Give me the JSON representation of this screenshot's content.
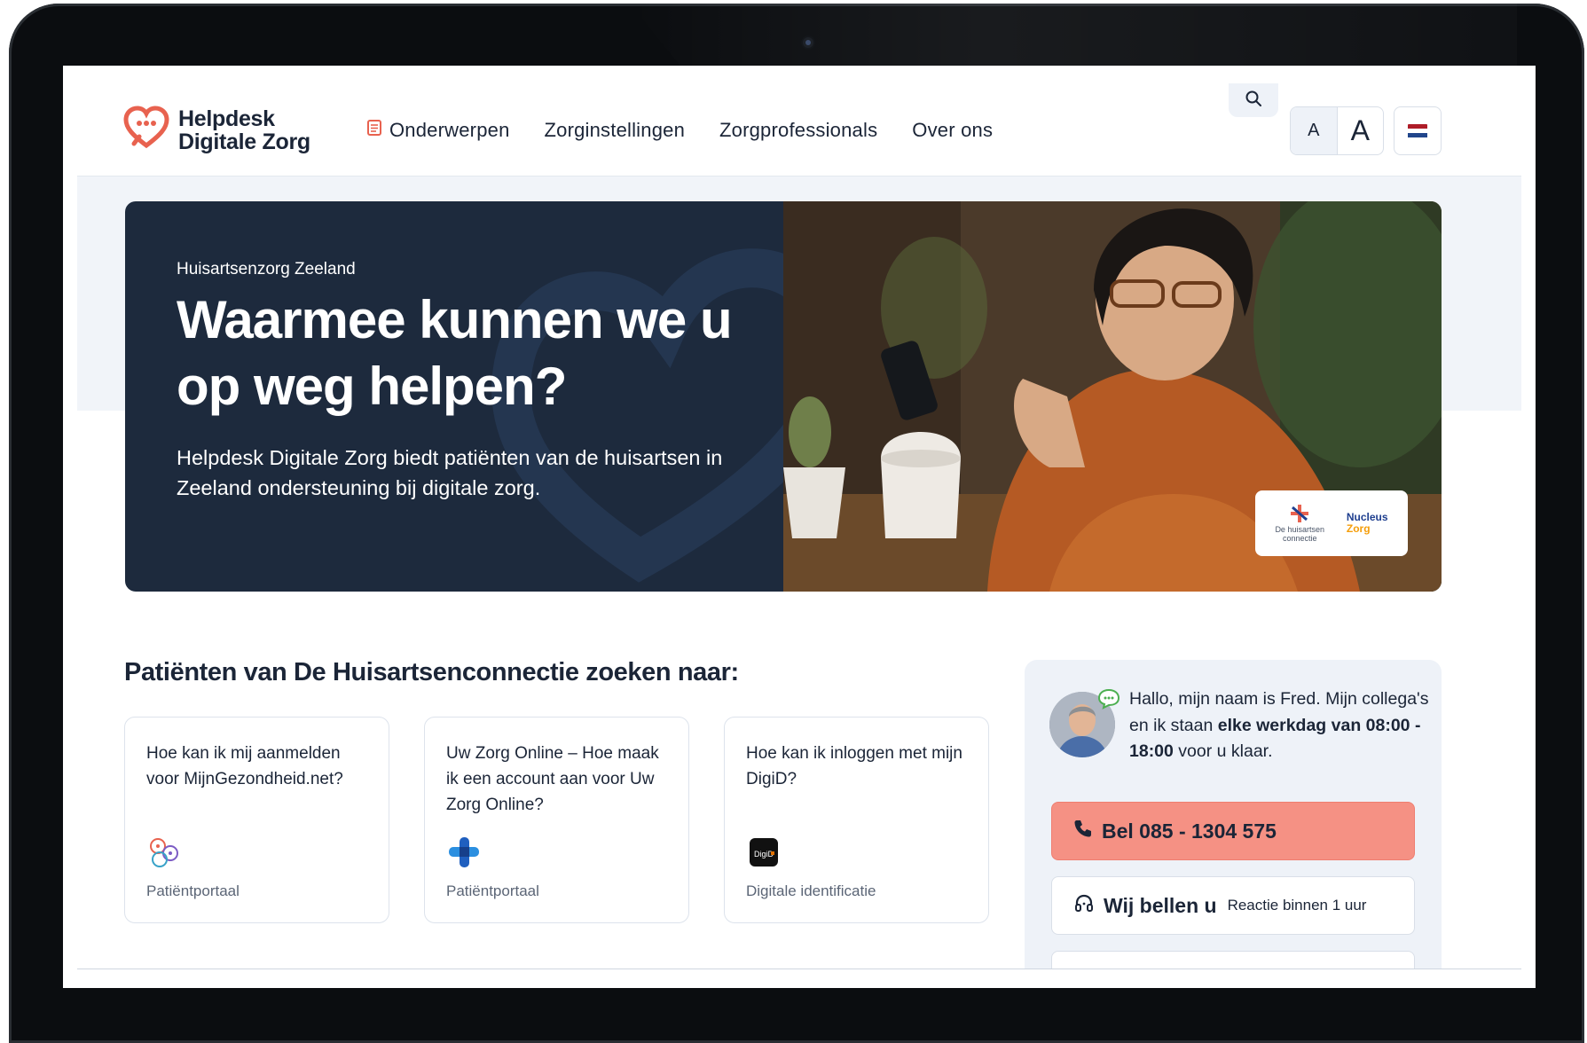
{
  "brand": {
    "name_line1": "Helpdesk",
    "name_line2": "Digitale Zorg",
    "accent": "#e8624f"
  },
  "nav": {
    "items": [
      {
        "label": "Onderwerpen",
        "icon": "book-icon"
      },
      {
        "label": "Zorginstellingen"
      },
      {
        "label": "Zorgprofessionals"
      },
      {
        "label": "Over ons"
      }
    ]
  },
  "toolbar": {
    "search_icon": "search-icon",
    "font_small_label": "A",
    "font_large_label": "A",
    "language_icon": "dutch-flag-icon"
  },
  "hero": {
    "eyebrow": "Huisartsenzorg Zeeland",
    "title": "Waarmee kunnen we u op weg helpen?",
    "description": "Helpdesk Digitale Zorg biedt patiënten van de huisartsen in Zeeland ondersteuning bij digitale zorg.",
    "background": "#1d2a3d"
  },
  "section": {
    "title": "Patiënten van De Huisartsenconnectie zoeken naar:"
  },
  "cards": [
    {
      "question": "Hoe kan ik mij aanmelden voor MijnGezondheid.net?",
      "category": "Patiëntportaal",
      "icon": "mijngezondheid-icon"
    },
    {
      "question": "Uw Zorg Online – Hoe maak ik een account aan voor Uw Zorg Online?",
      "category": "Patiëntportaal",
      "icon": "uw-zorg-online-icon"
    },
    {
      "question": "Hoe kan ik inloggen met mijn DigiD?",
      "category": "Digitale identificatie",
      "icon": "digid-icon"
    }
  ],
  "contact": {
    "intro": "Hallo, mijn naam is Fred. Mijn collega's en ik staan ",
    "hours_bold": "elke werkdag van 08:00 - 18:00",
    "outro": " voor u klaar.",
    "call_label": "Bel 085 - 1304 575",
    "callback_label": "Wij bellen u",
    "callback_sub": "Reactie binnen 1 uur",
    "call_color": "#f59184"
  }
}
